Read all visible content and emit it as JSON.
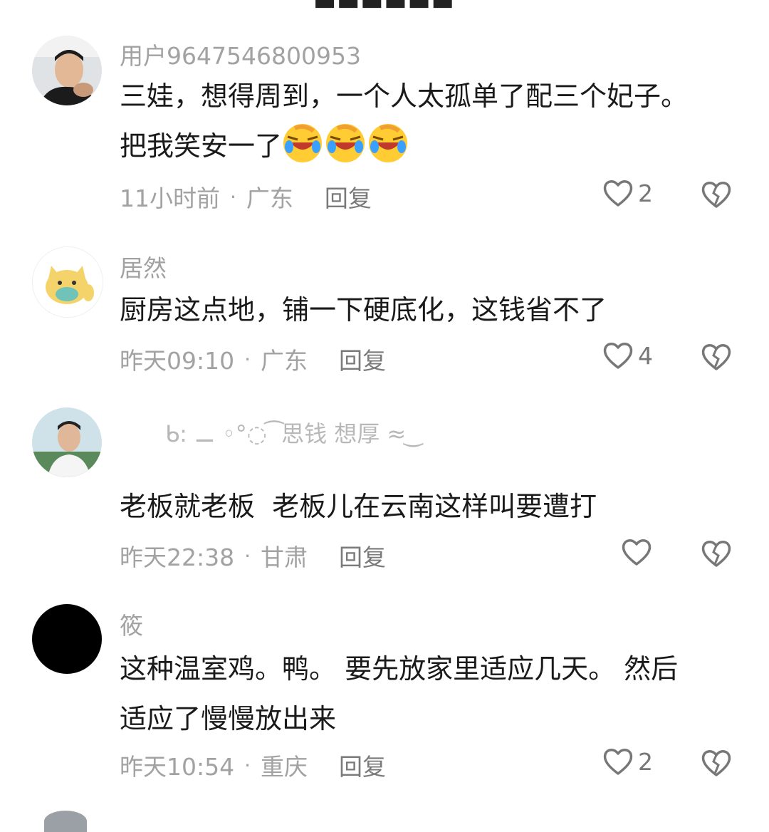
{
  "comments": [
    {
      "username": "用户9647546800953",
      "text_line1": "三娃，想得周到，一个人太孤单了配三个妃子。",
      "text_line2": "把我笑安一了",
      "time": "11小时前",
      "location": "广东",
      "reply": "回复",
      "likes": "2",
      "emojis": [
        "laugh-cry-emoji",
        "laugh-cry-emoji",
        "laugh-cry-emoji"
      ]
    },
    {
      "username": "居然",
      "text_line1": "厨房这点地，铺一下硬底化，这钱省不了",
      "time": "昨天09:10",
      "location": "广东",
      "reply": "回复",
      "likes": "4"
    },
    {
      "signature": "思钱 想厚",
      "text_line1": "老板就老板  老板儿在云南这样叫要遭打",
      "time": "昨天22:38",
      "location": "甘肃",
      "reply": "回复",
      "likes": ""
    },
    {
      "username": "筱",
      "text_line1": "这种温室鸡。鸭。 要先放家里适应几天。 然后",
      "text_line2": "适应了慢慢放出来",
      "time": "昨天10:54",
      "location": "重庆",
      "reply": "回复",
      "likes": "2"
    }
  ],
  "separator": "·",
  "colors": {
    "meta_gray": "#a2a2a2",
    "text": "#1a1a1a",
    "icon_gray": "#777777"
  }
}
